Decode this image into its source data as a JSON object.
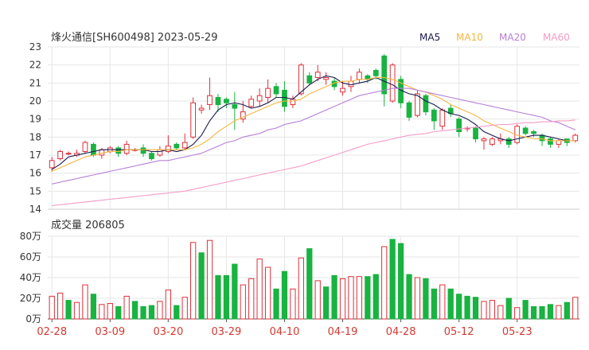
{
  "header": {
    "title": "烽火通信[SH600498] 2023-05-29",
    "legend": [
      {
        "label": "MA5",
        "color": "#1a1a4e"
      },
      {
        "label": "MA10",
        "color": "#f5b642"
      },
      {
        "label": "MA20",
        "color": "#b77fd8"
      },
      {
        "label": "MA60",
        "color": "#f49cc8"
      }
    ]
  },
  "volume_panel": {
    "title": "成交量 206805"
  },
  "colors": {
    "up": "#e0303a",
    "down": "#18b340",
    "grid": "#e6e6e6",
    "axis_text": "#333333",
    "date_text": "#d23a30"
  },
  "chart_data": [
    {
      "type": "candlestick",
      "title": "烽火通信[SH600498] 2023-05-29",
      "ylim": [
        14,
        23
      ],
      "y_ticks": [
        14,
        15,
        16,
        17,
        18,
        19,
        20,
        21,
        22,
        23
      ],
      "x_tick_labels": [
        "02-28",
        "03-09",
        "03-20",
        "03-29",
        "04-10",
        "04-19",
        "04-28",
        "05-12",
        "05-23"
      ],
      "x_tick_index": [
        0,
        7,
        14,
        21,
        28,
        35,
        42,
        49,
        56
      ],
      "candles": [
        [
          16.3,
          16.7,
          16.1,
          16.9
        ],
        [
          16.8,
          17.2,
          16.7,
          17.3
        ],
        [
          17.1,
          17.1,
          17.0,
          17.2
        ],
        [
          17.0,
          17.1,
          16.9,
          17.3
        ],
        [
          17.2,
          17.7,
          17.1,
          17.8
        ],
        [
          17.6,
          17.0,
          16.9,
          17.7
        ],
        [
          17.0,
          17.3,
          16.8,
          17.4
        ],
        [
          17.2,
          17.4,
          17.1,
          17.5
        ],
        [
          17.4,
          17.1,
          16.9,
          17.5
        ],
        [
          17.1,
          17.6,
          17.0,
          17.8
        ],
        [
          17.3,
          17.3,
          17.2,
          17.4
        ],
        [
          17.4,
          17.1,
          16.9,
          17.6
        ],
        [
          17.1,
          16.8,
          16.7,
          17.2
        ],
        [
          17.0,
          17.3,
          16.9,
          17.5
        ],
        [
          17.2,
          17.5,
          17.1,
          18.1
        ],
        [
          17.6,
          17.4,
          17.3,
          17.7
        ],
        [
          17.4,
          17.7,
          17.3,
          18.2
        ],
        [
          18.0,
          19.9,
          17.9,
          20.2
        ],
        [
          19.5,
          19.6,
          19.3,
          19.8
        ],
        [
          19.8,
          20.3,
          19.5,
          21.3
        ],
        [
          20.2,
          19.8,
          19.4,
          20.4
        ],
        [
          20.1,
          19.9,
          19.6,
          20.2
        ],
        [
          19.8,
          19.6,
          18.4,
          20.5
        ],
        [
          19.0,
          19.4,
          18.8,
          20.0
        ],
        [
          19.7,
          20.1,
          19.6,
          20.3
        ],
        [
          20.0,
          20.3,
          19.7,
          20.7
        ],
        [
          20.2,
          20.7,
          19.9,
          21.2
        ],
        [
          20.8,
          20.4,
          20.2,
          21.0
        ],
        [
          20.6,
          19.7,
          19.4,
          21.1
        ],
        [
          19.8,
          20.1,
          19.6,
          20.3
        ],
        [
          20.4,
          22.0,
          20.3,
          22.1
        ],
        [
          21.4,
          21.0,
          20.9,
          21.6
        ],
        [
          21.3,
          21.6,
          21.1,
          22.0
        ],
        [
          21.2,
          21.3,
          20.9,
          21.6
        ],
        [
          21.1,
          20.8,
          20.6,
          21.3
        ],
        [
          20.5,
          20.7,
          20.3,
          21.1
        ],
        [
          20.8,
          21.1,
          20.5,
          21.4
        ],
        [
          21.2,
          21.6,
          21.0,
          21.8
        ],
        [
          21.4,
          21.2,
          21.0,
          21.5
        ],
        [
          21.7,
          21.4,
          21.2,
          21.8
        ],
        [
          22.5,
          20.4,
          19.7,
          22.6
        ],
        [
          20.0,
          22.0,
          19.9,
          22.1
        ],
        [
          21.2,
          19.9,
          19.6,
          21.4
        ],
        [
          19.9,
          19.1,
          18.9,
          20.0
        ],
        [
          19.2,
          20.4,
          19.1,
          20.6
        ],
        [
          20.3,
          19.4,
          19.2,
          20.4
        ],
        [
          19.5,
          18.9,
          18.4,
          19.6
        ],
        [
          18.6,
          19.5,
          18.4,
          19.6
        ],
        [
          19.6,
          19.3,
          19.1,
          19.8
        ],
        [
          19.0,
          18.3,
          18.0,
          19.1
        ],
        [
          18.5,
          18.5,
          18.3,
          18.6
        ],
        [
          18.5,
          17.9,
          17.7,
          18.6
        ],
        [
          17.8,
          17.9,
          17.3,
          18.0
        ],
        [
          17.6,
          17.9,
          17.5,
          18.0
        ],
        [
          17.8,
          17.9,
          17.6,
          18.2
        ],
        [
          17.9,
          17.6,
          17.4,
          18.0
        ],
        [
          17.7,
          18.6,
          17.6,
          18.7
        ],
        [
          18.5,
          18.2,
          18.1,
          18.6
        ],
        [
          18.3,
          18.2,
          18.0,
          18.4
        ],
        [
          18.1,
          17.8,
          17.5,
          18.2
        ],
        [
          17.9,
          17.6,
          17.4,
          18.0
        ],
        [
          17.6,
          17.8,
          17.4,
          17.9
        ],
        [
          17.9,
          17.7,
          17.5,
          17.9
        ],
        [
          17.8,
          18.1,
          17.7,
          18.2
        ]
      ],
      "series": [
        {
          "name": "MA5",
          "values": [
            16.2,
            16.5,
            16.9,
            17.0,
            17.1,
            17.2,
            17.3,
            17.3,
            17.3,
            17.3,
            17.3,
            17.3,
            17.2,
            17.2,
            17.3,
            17.2,
            17.3,
            17.6,
            18.1,
            18.9,
            19.5,
            19.8,
            19.9,
            19.8,
            19.6,
            19.7,
            19.9,
            20.2,
            20.2,
            20.1,
            20.5,
            20.9,
            21.2,
            21.4,
            21.3,
            21.0,
            20.9,
            21.0,
            21.1,
            21.3,
            21.1,
            20.9,
            20.6,
            20.4,
            20.3,
            20.0,
            19.8,
            19.5,
            19.3,
            19.2,
            19.0,
            18.7,
            18.3,
            18.1,
            17.9,
            17.8,
            17.9,
            18.0,
            18.1,
            18.1,
            18.0,
            17.9,
            17.8,
            17.8
          ]
        },
        {
          "name": "MA10",
          "values": [
            16.1,
            16.3,
            16.5,
            16.7,
            16.9,
            17.0,
            17.1,
            17.2,
            17.2,
            17.3,
            17.3,
            17.3,
            17.3,
            17.3,
            17.3,
            17.3,
            17.3,
            17.4,
            17.6,
            17.9,
            18.3,
            18.6,
            18.9,
            19.1,
            19.3,
            19.5,
            19.7,
            19.9,
            20.0,
            20.0,
            20.1,
            20.4,
            20.6,
            20.8,
            21.0,
            21.1,
            21.1,
            21.2,
            21.2,
            21.3,
            21.3,
            21.2,
            21.0,
            20.8,
            20.6,
            20.5,
            20.3,
            20.1,
            19.8,
            19.6,
            19.4,
            19.2,
            18.9,
            18.7,
            18.5,
            18.3,
            18.1,
            18.0,
            17.9,
            17.9,
            17.8,
            17.8,
            17.8,
            17.8
          ]
        },
        {
          "name": "MA20",
          "values": [
            15.4,
            15.5,
            15.6,
            15.7,
            15.8,
            15.9,
            16.0,
            16.1,
            16.2,
            16.3,
            16.4,
            16.5,
            16.6,
            16.7,
            16.7,
            16.8,
            16.9,
            17.0,
            17.1,
            17.3,
            17.5,
            17.7,
            17.8,
            18.0,
            18.1,
            18.2,
            18.4,
            18.5,
            18.7,
            18.8,
            18.9,
            19.1,
            19.3,
            19.5,
            19.7,
            19.9,
            20.1,
            20.3,
            20.4,
            20.5,
            20.6,
            20.7,
            20.7,
            20.7,
            20.6,
            20.5,
            20.4,
            20.3,
            20.2,
            20.1,
            20.0,
            19.9,
            19.8,
            19.7,
            19.6,
            19.5,
            19.4,
            19.3,
            19.2,
            19.1,
            18.9,
            18.8,
            18.6,
            18.4
          ]
        },
        {
          "name": "MA60",
          "values": [
            14.2,
            14.25,
            14.3,
            14.35,
            14.4,
            14.45,
            14.5,
            14.55,
            14.6,
            14.65,
            14.7,
            14.75,
            14.8,
            14.85,
            14.9,
            14.95,
            15.0,
            15.1,
            15.2,
            15.3,
            15.4,
            15.5,
            15.6,
            15.7,
            15.8,
            15.9,
            16.0,
            16.1,
            16.2,
            16.3,
            16.4,
            16.55,
            16.7,
            16.85,
            17.0,
            17.15,
            17.3,
            17.45,
            17.6,
            17.7,
            17.8,
            17.9,
            18.0,
            18.1,
            18.15,
            18.2,
            18.3,
            18.35,
            18.4,
            18.45,
            18.5,
            18.55,
            18.6,
            18.65,
            18.7,
            18.7,
            18.75,
            18.8,
            18.8,
            18.85,
            18.85,
            18.9,
            18.9,
            18.95
          ]
        }
      ]
    },
    {
      "type": "bar",
      "title": "成交量 206805",
      "ylim": [
        0,
        80
      ],
      "y_ticks": [
        0,
        20,
        40,
        60,
        80
      ],
      "y_tick_labels": [
        "0万",
        "20万",
        "40万",
        "60万",
        "80万"
      ],
      "x_tick_labels": [
        "02-28",
        "03-09",
        "03-20",
        "03-29",
        "04-10",
        "04-19",
        "04-28",
        "05-12",
        "05-23"
      ],
      "x_tick_index": [
        0,
        7,
        14,
        21,
        28,
        35,
        42,
        49,
        56
      ],
      "values": [
        22,
        25,
        18,
        16,
        33,
        24,
        14,
        15,
        12,
        22,
        17,
        12,
        13,
        17,
        28,
        13,
        21,
        74,
        64,
        76,
        42,
        42,
        53,
        33,
        39,
        58,
        50,
        29,
        46,
        29,
        59,
        68,
        37,
        31,
        42,
        39,
        41,
        41,
        41,
        43,
        70,
        77,
        73,
        43,
        40,
        39,
        29,
        33,
        29,
        24,
        22,
        21,
        17,
        18,
        13,
        20,
        11,
        18,
        12,
        12,
        14,
        13,
        16,
        21
      ],
      "up": [
        1,
        1,
        0,
        1,
        1,
        0,
        1,
        1,
        0,
        1,
        0,
        0,
        0,
        1,
        1,
        0,
        1,
        1,
        0,
        1,
        0,
        0,
        0,
        1,
        1,
        1,
        1,
        0,
        0,
        1,
        1,
        0,
        1,
        0,
        0,
        1,
        1,
        1,
        0,
        0,
        1,
        0,
        0,
        0,
        1,
        0,
        0,
        1,
        0,
        0,
        0,
        0,
        1,
        1,
        1,
        0,
        1,
        0,
        0,
        0,
        0,
        1,
        0,
        1
      ]
    }
  ]
}
